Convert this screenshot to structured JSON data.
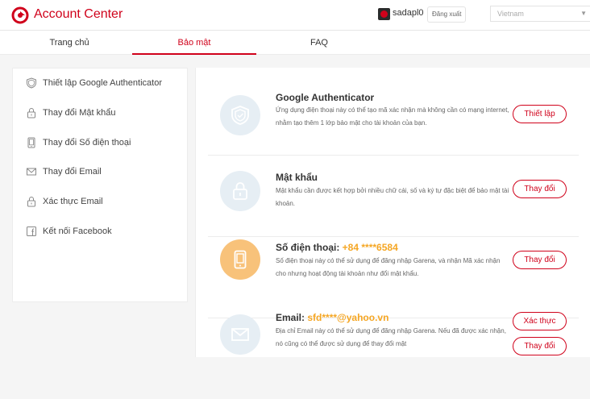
{
  "header": {
    "brand": "Account Center",
    "username": "sadapl0",
    "logout_label": "Đăng xuất",
    "region": "Vietnam"
  },
  "nav": {
    "tabs": [
      {
        "label": "Trang chủ",
        "active": false
      },
      {
        "label": "Bảo mật",
        "active": true
      },
      {
        "label": "FAQ",
        "active": false
      }
    ]
  },
  "sidebar": {
    "items": [
      {
        "label": "Thiết lập Google Authenticator",
        "icon": "shield-icon"
      },
      {
        "label": "Thay đổi Mật khẩu",
        "icon": "lock-icon"
      },
      {
        "label": "Thay đổi Số điện thoại",
        "icon": "phone-icon"
      },
      {
        "label": "Thay đổi Email",
        "icon": "envelope-icon"
      },
      {
        "label": "Xác thực Email",
        "icon": "lock-icon"
      },
      {
        "label": "Kết nối Facebook",
        "icon": "facebook-icon"
      }
    ]
  },
  "main": {
    "items": [
      {
        "title": "Google Authenticator",
        "highlight": "",
        "desc": "Ứng dụng điện thoại này có thể tạo mã xác nhận mà không cần có mạng internet, nhằm tạo thêm 1 lớp bảo mật cho tài khoản của bạn.",
        "button": "Thiết lập",
        "icon": "shield-icon"
      },
      {
        "title": "Mật khẩu",
        "highlight": "",
        "desc": "Mật khẩu cần được kết hợp bởi nhiều chữ cái, số và ký tự đặc biệt để bảo mật tài khoản.",
        "button": "Thay đổi",
        "icon": "lock-icon"
      },
      {
        "title": "Số điện thoại: ",
        "highlight": "+84 ****6584",
        "desc": "Số điện thoại này có thể sử dụng để đăng nhập Garena, và nhận Mã xác nhận cho nhưng hoạt động tài khoản như đổi mật khẩu.",
        "button": "Thay đổi",
        "icon": "phone-icon"
      },
      {
        "title": "Email: ",
        "highlight": "sfd****@yahoo.vn",
        "desc": "Địa chỉ Email này có thể sử dụng để đăng nhập Garena. Nếu đã được xác nhận, nó cũng có thể được sử dụng để thay đổi mật",
        "button": "Xác thực",
        "button2": "Thay đổi",
        "icon": "envelope-icon"
      }
    ]
  },
  "colors": {
    "brand": "#d0021b",
    "highlight": "#f5a623",
    "icon_circle": "#e6eef4",
    "icon_circle_active": "#f8c27a"
  }
}
